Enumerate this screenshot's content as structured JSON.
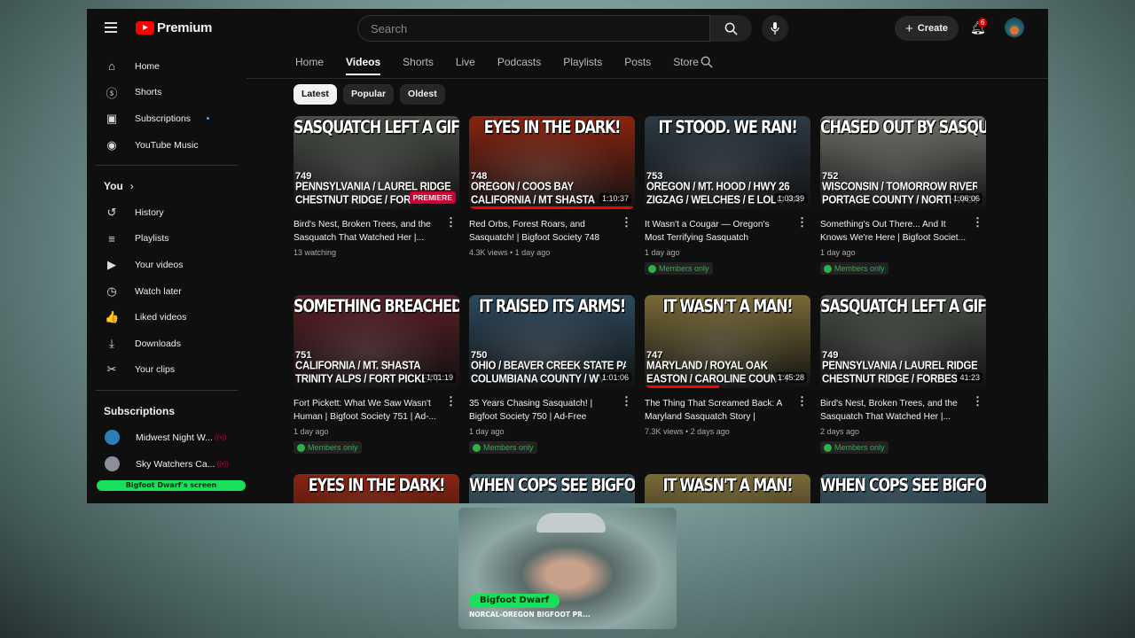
{
  "header": {
    "logo": "Premium",
    "search_placeholder": "Search",
    "create": "Create",
    "notifications": "6"
  },
  "sidebar": {
    "main": [
      {
        "label": "Home",
        "icon": "⌂"
      },
      {
        "label": "Shorts",
        "icon": "ⓢ"
      },
      {
        "label": "Subscriptions",
        "icon": "▣"
      },
      {
        "label": "YouTube Music",
        "icon": "◉"
      }
    ],
    "you_label": "You",
    "you": [
      {
        "label": "History",
        "icon": "↺"
      },
      {
        "label": "Playlists",
        "icon": "≡"
      },
      {
        "label": "Your videos",
        "icon": "▶"
      },
      {
        "label": "Watch later",
        "icon": "◷"
      },
      {
        "label": "Liked videos",
        "icon": "👍"
      },
      {
        "label": "Downloads",
        "icon": "⤓"
      },
      {
        "label": "Your clips",
        "icon": "✂"
      }
    ],
    "subs_label": "Subscriptions",
    "subs": [
      {
        "label": "Midwest Night W...",
        "color": "#2a7fb5"
      },
      {
        "label": "Sky Watchers Ca...",
        "color": "#8a8f98"
      }
    ]
  },
  "screen_label": "Bigfoot Dwarf's screen",
  "tabs": [
    "Home",
    "Videos",
    "Shorts",
    "Live",
    "Podcasts",
    "Playlists",
    "Posts",
    "Store"
  ],
  "chips": [
    "Latest",
    "Popular",
    "Oldest"
  ],
  "videos": [
    {
      "headline": "SASQUATCH LEFT A GIFT!",
      "num": "749",
      "line1": "PENNSYLVANIA / LAUREL RIDGE",
      "line2": "CHESTNUT RIDGE / FORBES",
      "badge": "PREMIERE",
      "title": "Bird's Nest, Broken Trees, and the Sasquatch That Watched Her |...",
      "meta": "13 watching",
      "bg": "#4a4f48"
    },
    {
      "headline": "EYES IN THE DARK!",
      "num": "748",
      "line1": "OREGON / COOS BAY",
      "line2": "CALIFORNIA / MT SHASTA",
      "duration": "1:10:37",
      "progress": 100,
      "title": "Red Orbs, Forest Roars, and Sasquatch! | Bigfoot Society 748",
      "meta": "4.3K views • 1 day ago",
      "bg": "#8a2410"
    },
    {
      "headline": "IT STOOD. WE RAN!",
      "num": "753",
      "line1": "OREGON / MT. HOOD / HWY 26",
      "line2": "ZIGZAG / WELCHES / E LOLO PASS RD",
      "duration": "1:03:39",
      "title": "It Wasn't a Cougar — Oregon's Most Terrifying Sasquatch Encounter |...",
      "meta": "1 day ago",
      "members": "Members only",
      "bg": "#2c3a44"
    },
    {
      "headline": "CHASED OUT BY SASQUATCH!",
      "num": "752",
      "line1": "WISCONSIN / TOMORROW RIVER",
      "line2": "PORTAGE COUNTY / NORTHWOODS",
      "duration": "1:06:06",
      "title": "Something's Out There... And It Knows We're Here | Bigfoot Societ...",
      "meta": "1 day ago",
      "members": "Members only",
      "bg": "#6d716a"
    },
    {
      "headline": "SOMETHING BREACHED THE PERIMETER!",
      "num": "751",
      "line1": "CALIFORNIA / MT. SHASTA",
      "line2": "TRINITY ALPS / FORT PICKETT",
      "duration": "1:01:19",
      "title": "Fort Pickett: What We Saw Wasn't Human | Bigfoot Society 751 | Ad-...",
      "meta": "1 day ago",
      "members": "Members only",
      "bg": "#5a1e26"
    },
    {
      "headline": "IT RAISED ITS ARMS!",
      "num": "750",
      "line1": "OHIO / BEAVER CREEK STATE PARK",
      "line2": "COLUMBIANA COUNTY / WV",
      "duration": "1:01:06",
      "title": "35 Years Chasing Sasquatch! | Bigfoot Society 750 | Ad-Free",
      "meta": "1 day ago",
      "members": "Members only",
      "bg": "#2d4a5e"
    },
    {
      "headline": "IT WASN'T A MAN!",
      "num": "747",
      "line1": "MARYLAND / ROYAL OAK",
      "line2": "EASTON / CAROLINE COUNTY",
      "duration": "1:45:28",
      "progress": 45,
      "title": "The Thing That Screamed Back: A Maryland Sasquatch Story | Bigfoo...",
      "meta": "7.3K views • 2 days ago",
      "bg": "#7a6a36"
    },
    {
      "headline": "SASQUATCH LEFT A GIFT!",
      "num": "749",
      "line1": "PENNSYLVANIA / LAUREL RIDGE",
      "line2": "CHESTNUT RIDGE / FORBES",
      "duration": "41:23",
      "title": "Bird's Nest, Broken Trees, and the Sasquatch That Watched Her |...",
      "meta": "2 days ago",
      "members": "Members only",
      "bg": "#4a4f48"
    },
    {
      "headline": "EYES IN THE DARK!",
      "bg": "#8a2410"
    },
    {
      "headline": "WHEN COPS SEE BIGFOOT.",
      "bg": "#3a5866"
    },
    {
      "headline": "IT WASN'T A MAN!",
      "bg": "#7a6a36"
    },
    {
      "headline": "WHEN COPS SEE BIGFOOT.",
      "bg": "#3a5866"
    }
  ],
  "webcam": {
    "name": "Bigfoot Dwarf",
    "tagline": "NORCAL-OREGON BIGFOOT PR..."
  }
}
